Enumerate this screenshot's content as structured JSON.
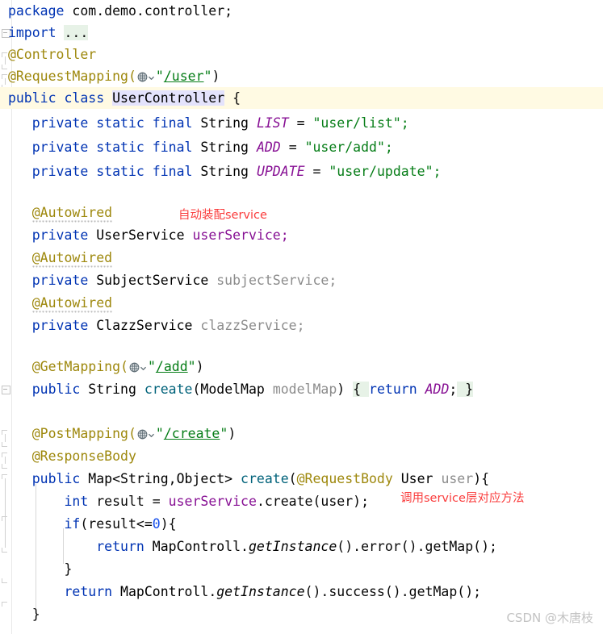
{
  "app": {
    "kind": "code-editor",
    "language": "Java",
    "theme": "IntelliJ Light",
    "background": "#ffffff",
    "current_line_background": "#fffae3"
  },
  "colors": {
    "keyword": "#0033b3",
    "string": "#067d17",
    "annotation": "#9e880d",
    "field": "#871094",
    "method": "#00627a",
    "parameter": "#8c8c8c",
    "number": "#1750eb",
    "plain_text": "#080808",
    "identifier_highlight": "#e4e3fc",
    "folded_region": "#e7f2e7",
    "note_red": "#fa3c3c",
    "watermark_gray": "#c3c3c3"
  },
  "code": {
    "lines": [
      {
        "n": 1,
        "text": "package com.demo.controller;"
      },
      {
        "n": 2,
        "text": "import ..."
      },
      {
        "n": 3,
        "text": "@Controller"
      },
      {
        "n": 4,
        "text": "@RequestMapping(\"/user\")"
      },
      {
        "n": 5,
        "text": "public class UserController {"
      },
      {
        "n": 6,
        "text": "    private static final String LIST = \"user/list\";"
      },
      {
        "n": 7,
        "text": "    private static final String ADD = \"user/add\";"
      },
      {
        "n": 8,
        "text": "    private static final String UPDATE = \"user/update\";"
      },
      {
        "n": 9,
        "text": ""
      },
      {
        "n": 10,
        "text": "    @Autowired"
      },
      {
        "n": 11,
        "text": "    private UserService userService;"
      },
      {
        "n": 12,
        "text": "    @Autowired"
      },
      {
        "n": 13,
        "text": "    private SubjectService subjectService;"
      },
      {
        "n": 14,
        "text": "    @Autowired"
      },
      {
        "n": 15,
        "text": "    private ClazzService clazzService;"
      },
      {
        "n": 16,
        "text": ""
      },
      {
        "n": 17,
        "text": "    @GetMapping(\"/add\")"
      },
      {
        "n": 18,
        "text": "    public String create(ModelMap modelMap) { return ADD; }"
      },
      {
        "n": 19,
        "text": ""
      },
      {
        "n": 20,
        "text": "    @PostMapping(\"/create\")"
      },
      {
        "n": 21,
        "text": "    @ResponseBody"
      },
      {
        "n": 22,
        "text": "    public Map<String,Object> create(@RequestBody User user){"
      },
      {
        "n": 23,
        "text": "        int result = userService.create(user);"
      },
      {
        "n": 24,
        "text": "        if(result<=0){"
      },
      {
        "n": 25,
        "text": "            return MapControll.getInstance().error().getMap();"
      },
      {
        "n": 26,
        "text": "        }"
      },
      {
        "n": 27,
        "text": "        return MapControll.getInstance().success().getMap();"
      },
      {
        "n": 28,
        "text": "    }"
      }
    ],
    "tokens": {
      "kw_package": "package",
      "pkg_name": "com.demo.controller;",
      "kw_import": "import",
      "folded_imports": "...",
      "anno_controller": "@Controller",
      "anno_requestmapping": "@RequestMapping(",
      "url_user": "/user",
      "kw_public": "public",
      "kw_class": "class",
      "ident_usercontroller": "UserController",
      "brace_open": "{",
      "brace_close": "}",
      "kw_private": "private",
      "kw_static": "static",
      "kw_final": "final",
      "type_string": "String",
      "const_list": "LIST",
      "const_add": "ADD",
      "const_update": "UPDATE",
      "eq": "=",
      "str_user_list": "\"user/list\";",
      "str_user_add": "\"user/add\";",
      "str_user_update": "\"user/update\";",
      "anno_autowired": "@Autowired",
      "type_userservice": "UserService",
      "field_userservice": "userService;",
      "type_subjectservice": "SubjectService",
      "field_subjectservice": "subjectService;",
      "type_clazzservice": "ClazzService",
      "field_clazzservice": "clazzService;",
      "anno_getmapping": "@GetMapping(",
      "url_add": "/add",
      "anno_postmapping": "@PostMapping(",
      "url_create": "/create",
      "anno_responsebody": "@ResponseBody",
      "type_map_generic": "Map<String,Object>",
      "method_create": "create",
      "type_modelmap": "ModelMap",
      "param_modelmap": "modelMap",
      "kw_return": "return",
      "anno_requestbody": "@RequestBody",
      "type_user": "User",
      "param_user": "user",
      "kw_int": "int",
      "var_result": "result",
      "call_create_user": ".create(user);",
      "kw_if": "if",
      "cond_result": "(result<=",
      "num_zero": "0",
      "cond_close": "){",
      "type_mapcontroll": "MapControll",
      "static_getinstance": "getInstance",
      "call_error": "().error().getMap();",
      "call_success": "().success().getMap();"
    }
  },
  "notes": [
    {
      "id": "note-autowire",
      "text": "自动装配service"
    },
    {
      "id": "note-service-call",
      "text": "调用service层对应方法"
    }
  ],
  "watermark": {
    "text": "CSDN @木唐枝"
  },
  "gutter": {
    "icons": [
      {
        "type": "fold-collapsed",
        "line": 2
      },
      {
        "type": "fold-expanded-start",
        "line": 3
      },
      {
        "type": "fold-expanded-start",
        "line": 4
      },
      {
        "type": "fold-collapsed",
        "line": 18
      },
      {
        "type": "fold-expanded-start",
        "line": 20
      },
      {
        "type": "fold-expanded-start",
        "line": 21
      },
      {
        "type": "fold-expanded-start",
        "line": 22
      },
      {
        "type": "fold-expanded-start",
        "line": 24
      },
      {
        "type": "fold-expanded-end",
        "line": 26
      },
      {
        "type": "fold-expanded-end",
        "line": 28
      }
    ]
  },
  "inline_icons": {
    "globe": "globe-icon",
    "chevron_down": "chevron-down-icon"
  }
}
